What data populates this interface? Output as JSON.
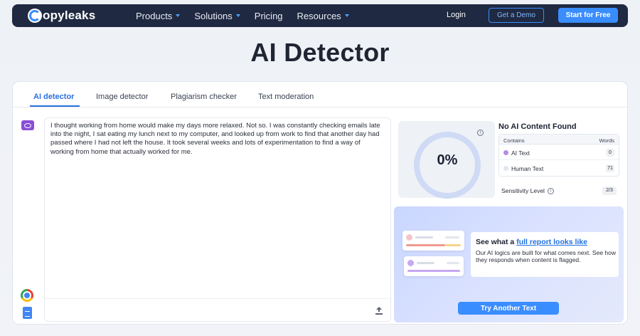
{
  "nav": {
    "brand": "opyleaks",
    "links": [
      {
        "label": "Products",
        "has_menu": true
      },
      {
        "label": "Solutions",
        "has_menu": true
      },
      {
        "label": "Pricing",
        "has_menu": false
      },
      {
        "label": "Resources",
        "has_menu": true
      }
    ],
    "login": "Login",
    "demo": "Get a Demo",
    "start": "Start for Free"
  },
  "page": {
    "title": "AI Detector"
  },
  "tabs": [
    {
      "label": "AI detector",
      "active": true
    },
    {
      "label": "Image detector",
      "active": false
    },
    {
      "label": "Plagiarism checker",
      "active": false
    },
    {
      "label": "Text moderation",
      "active": false
    }
  ],
  "editor": {
    "text": "I thought working from home would make my days more relaxed. Not so. I was constantly checking emails late into the night, I sat eating my lunch next to my computer, and looked up from work to find that another day had passed where I had not left the house. It took several weeks and lots of experimentation to find a way of working from home that actually worked for me."
  },
  "result": {
    "percent": "0%",
    "title": "No AI Content Found",
    "table_headers": {
      "contains": "Contains",
      "words": "Words"
    },
    "rows": [
      {
        "label": "AI Text",
        "count": "0",
        "color": "#b48ce8"
      },
      {
        "label": "Human Text",
        "count": "71",
        "color": "#dfe5f3"
      }
    ],
    "sensitivity_label": "Sensitivity Level",
    "sensitivity_value": "2/3"
  },
  "promo": {
    "title_prefix": "See what a ",
    "title_link": "full report looks like",
    "description": "Our AI logics are built for what comes next. See how they responds when content is flagged.",
    "button": "Try Another Text"
  },
  "colors": {
    "nav_bg": "#1f2941",
    "accent": "#3a8dff",
    "tab_active": "#2b6fe0"
  }
}
